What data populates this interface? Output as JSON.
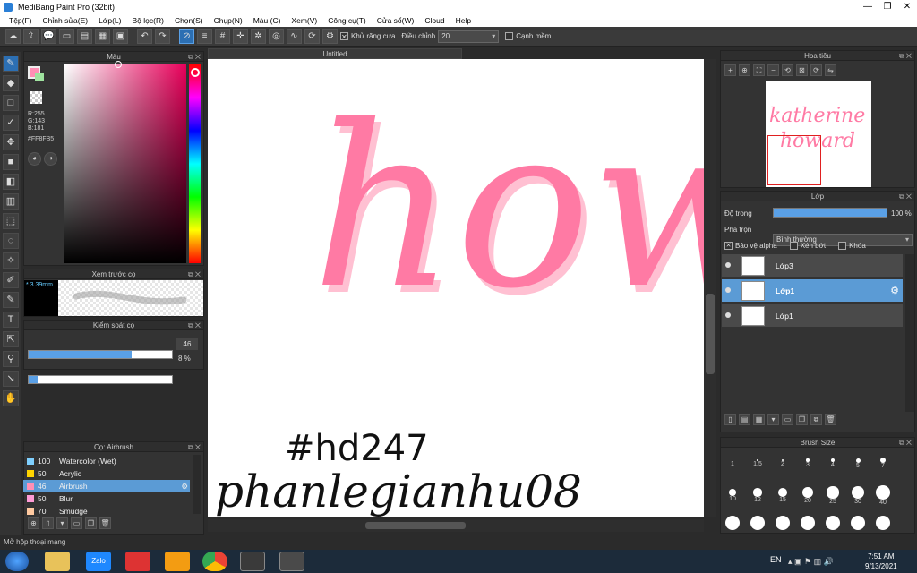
{
  "window": {
    "title": "MediBang Paint Pro (32bit)"
  },
  "menu": [
    "Tệp(F)",
    "Chỉnh sửa(E)",
    "Lớp(L)",
    "Bộ lọc(R)",
    "Chọn(S)",
    "Chụp(N)",
    "Màu (C)",
    "Xem(V)",
    "Công cụ(T)",
    "Cửa sổ(W)",
    "Cloud",
    "Help"
  ],
  "toolbar": {
    "antialias_label": "Khử răng cưa",
    "adjust_label": "Điều chỉnh",
    "adjust_value": "20",
    "edge_label": "Cạnh mềm"
  },
  "color_panel": {
    "title": "Màu",
    "r": "R:255",
    "g": "G:143",
    "b": "B:181",
    "hex": "#FF8FB5",
    "fg_color": "#ff8fb5"
  },
  "brush_preview": {
    "title": "Xem trước cọ",
    "size": "3.39mm"
  },
  "brush_control": {
    "title": "Kiểm soát cọ",
    "size_value": "46",
    "size_fill": 0.72,
    "opacity_value": "8 %",
    "opacity_fill": 0.06
  },
  "brush_list": {
    "title": "Cọ: Airbrush",
    "items": [
      {
        "num": "100",
        "label": "Watercolor (Wet)",
        "color": "#7fd0ff",
        "selected": false
      },
      {
        "num": "50",
        "label": "Acrylic",
        "color": "#ffd400",
        "selected": false
      },
      {
        "num": "46",
        "label": "Airbrush",
        "color": "#ff8fb5",
        "selected": true
      },
      {
        "num": "50",
        "label": "Blur",
        "color": "#ff9bd6",
        "selected": false
      },
      {
        "num": "70",
        "label": "Smudge",
        "color": "#ffc9a0",
        "selected": false
      }
    ]
  },
  "canvas": {
    "tab": "Untitled",
    "word": "how",
    "handwritten_tag": "#hd247",
    "handwritten_name": "phanlegianhu08"
  },
  "navigator": {
    "title": "Hoa tiêu",
    "line1": "katherine",
    "line2": "howard"
  },
  "layers": {
    "title": "Lớp",
    "opacity_label": "Độ trong",
    "opacity_value": "100 %",
    "blend_label": "Pha trộn",
    "blend_value": "Bình thường",
    "protect_alpha": "Bảo vệ alpha",
    "clip": "Xén bớt",
    "lock": "Khóa",
    "items": [
      {
        "name": "Lớp3",
        "selected": false
      },
      {
        "name": "Lớp1",
        "selected": true
      },
      {
        "name": "Lớp1",
        "selected": false
      }
    ]
  },
  "brush_size": {
    "title": "Brush Size",
    "row1": [
      "1",
      "1.5",
      "2",
      "3",
      "4",
      "5",
      "7"
    ],
    "row2": [
      "10",
      "12",
      "15",
      "20",
      "25",
      "30",
      "40"
    ]
  },
  "status": {
    "text": "Mở hộp thoại mạng"
  },
  "taskbar": {
    "lang": "EN",
    "time": "7:51 AM",
    "date": "9/13/2021",
    "zalo": "Zalo"
  }
}
